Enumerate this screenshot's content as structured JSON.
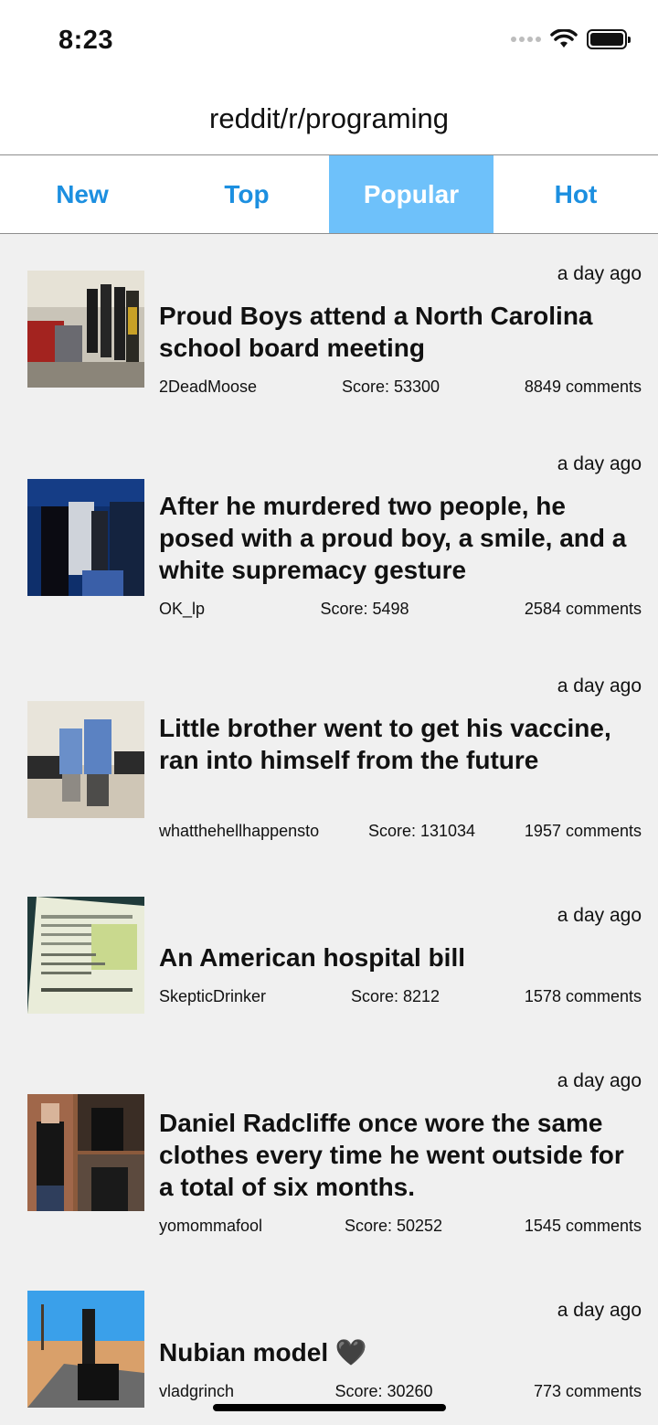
{
  "status": {
    "time": "8:23"
  },
  "nav": {
    "title": "reddit/r/programing"
  },
  "tabs": [
    {
      "label": "New",
      "active": false
    },
    {
      "label": "Top",
      "active": false
    },
    {
      "label": "Popular",
      "active": true
    },
    {
      "label": "Hot",
      "active": false
    }
  ],
  "posts": [
    {
      "time": "a day ago",
      "title": "Proud Boys attend a North Carolina school board meeting",
      "author": "2DeadMoose",
      "score": "Score: 53300",
      "comments": "8849 comments"
    },
    {
      "time": "a day ago",
      "title": "After he murdered two people, he posed with a proud boy, a smile, and a white supremacy gesture",
      "author": "OK_lp",
      "score": "Score: 5498",
      "comments": "2584 comments"
    },
    {
      "time": "a day ago",
      "title": "Little brother went to get his vaccine, ran into himself from the future",
      "author": "whatthehellhappensto",
      "score": "Score: 131034",
      "comments": "1957 comments"
    },
    {
      "time": "a day ago",
      "title": "An American hospital bill",
      "author": "SkepticDrinker",
      "score": "Score: 8212",
      "comments": "1578 comments"
    },
    {
      "time": "a day ago",
      "title": "Daniel Radcliffe once wore the same clothes every time he went outside for a total of six months.",
      "author": "yomommafool",
      "score": "Score: 50252",
      "comments": "1545 comments"
    },
    {
      "time": "a day ago",
      "title": "Nubian model 🖤",
      "author": "vladgrinch",
      "score": "Score: 30260",
      "comments": "773 comments"
    }
  ]
}
